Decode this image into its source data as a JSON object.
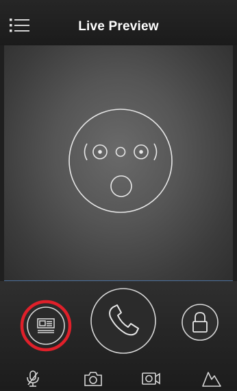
{
  "header": {
    "title": "Live Preview",
    "menu_icon": "list-menu-icon"
  },
  "preview": {
    "placeholder_icon": "surprised-face-icon"
  },
  "controls": {
    "message_icon": "message-card-icon",
    "call_icon": "phone-handset-icon",
    "unlock_icon": "padlock-icon",
    "highlight_color": "#e0202a"
  },
  "toolbar": {
    "icons": [
      "microphone-icon",
      "camera-icon",
      "video-record-icon",
      "mountain-chart-icon"
    ]
  },
  "colors": {
    "background": "#1f1f1f",
    "icon_stroke": "#d8d8d8",
    "divider_blue": "#4c6f9a"
  }
}
